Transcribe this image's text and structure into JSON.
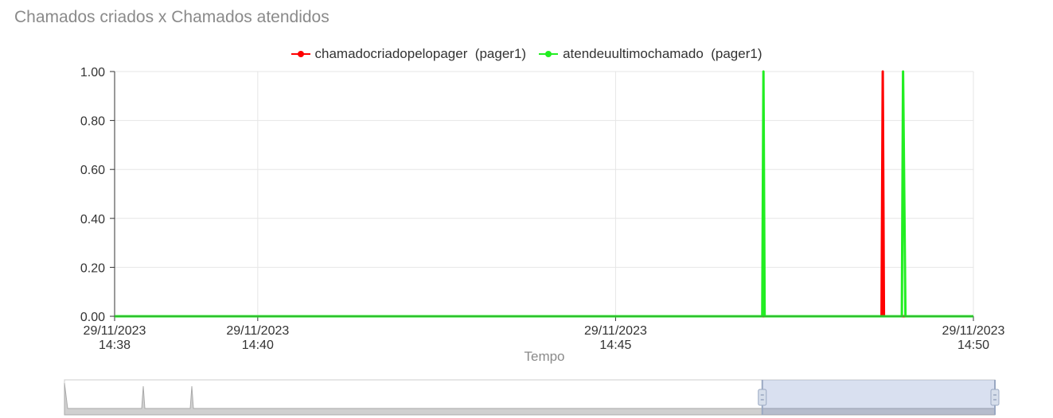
{
  "title": "Chamados criados x Chamados atendidos",
  "colors": {
    "series1": "#ff0000",
    "series2": "#22ee22",
    "grid": "#e6e6e6",
    "axis": "#333333"
  },
  "chart_data": {
    "type": "line",
    "title": "Chamados criados x Chamados atendidos",
    "xlabel": "Tempo",
    "ylabel": "",
    "ylim": [
      0,
      1
    ],
    "yticks": [
      "0.00",
      "0.20",
      "0.40",
      "0.60",
      "0.80",
      "1.00"
    ],
    "xlim": [
      "29/11/2023 14:38",
      "29/11/2023 14:50"
    ],
    "xticks": [
      {
        "date": "29/11/2023",
        "time": "14:38"
      },
      {
        "date": "29/11/2023",
        "time": "14:40"
      },
      {
        "date": "29/11/2023",
        "time": "14:45"
      },
      {
        "date": "29/11/2023",
        "time": "14:50"
      }
    ],
    "legend_position": "top-center",
    "grid": true,
    "series": [
      {
        "name": "chamadocriadopelopager  (pager1)",
        "color": "#ff0000",
        "points": [
          [
            "29/11/2023 14:38:00",
            0
          ],
          [
            "29/11/2023 14:48:43",
            0
          ],
          [
            "29/11/2023 14:48:44",
            1
          ],
          [
            "29/11/2023 14:48:45",
            0
          ],
          [
            "29/11/2023 14:50:00",
            0
          ]
        ]
      },
      {
        "name": "atendeuultimochamado  (pager1)",
        "color": "#22ee22",
        "points": [
          [
            "29/11/2023 14:38:00",
            0
          ],
          [
            "29/11/2023 14:47:03",
            0
          ],
          [
            "29/11/2023 14:47:04",
            1
          ],
          [
            "29/11/2023 14:47:05",
            0
          ],
          [
            "29/11/2023 14:49:00",
            0
          ],
          [
            "29/11/2023 14:49:01",
            1
          ],
          [
            "29/11/2023 14:49:03",
            0
          ],
          [
            "29/11/2023 14:50:00",
            0
          ]
        ]
      }
    ],
    "navigator": {
      "selected_range": [
        "29/11/2023 14:47",
        "29/11/2023 14:50"
      ]
    }
  }
}
